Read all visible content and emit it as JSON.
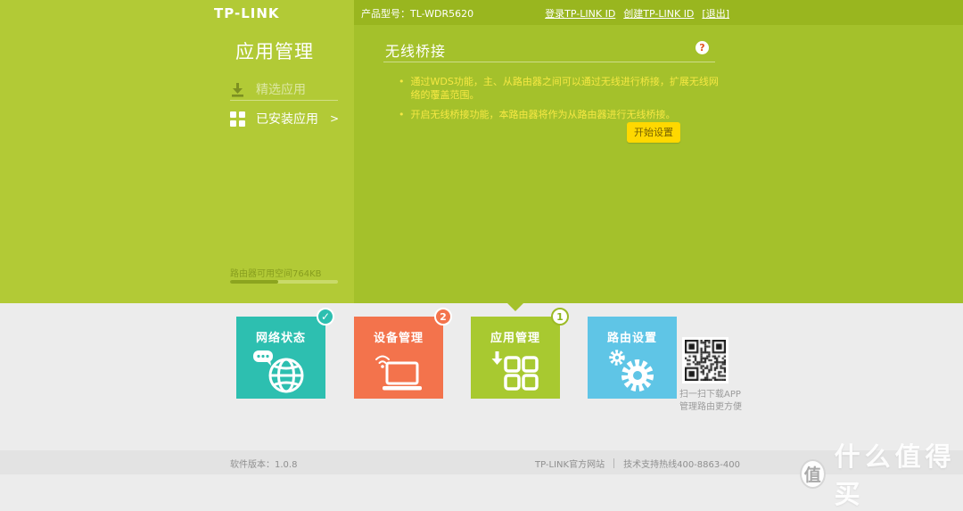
{
  "header": {
    "logo": "TP-LINK",
    "product_label": "产品型号：TL-WDR5620",
    "links": [
      {
        "label": "登录TP-LINK ID"
      },
      {
        "label": "创建TP-LINK ID"
      },
      {
        "label": "[退出]"
      }
    ]
  },
  "sidebar": {
    "title": "应用管理",
    "items": [
      {
        "label": "精选应用",
        "icon": "download-icon",
        "active": false
      },
      {
        "label": "已安装应用",
        "icon": "grid-icon",
        "active": true,
        "arrow": ">"
      }
    ],
    "storage": {
      "label": "路由器可用空间764KB",
      "percent": 45
    }
  },
  "main": {
    "title": "无线桥接",
    "help_icon": "?",
    "bullets": [
      "通过WDS功能，主、从路由器之间可以通过无线进行桥接，扩展无线网络的覆盖范围。",
      "开启无线桥接功能，本路由器将作为从路由器进行无线桥接。"
    ],
    "bullet_dot": "•",
    "start_button": "开始设置"
  },
  "nav_tiles": [
    {
      "label": "网络状态",
      "color": "#2dbfb0",
      "badge": "✓",
      "badge_type": "check",
      "icon": "globe-chat-icon"
    },
    {
      "label": "设备管理",
      "color": "#f3734c",
      "badge": "2",
      "badge_type": "count",
      "icon": "laptop-wifi-icon"
    },
    {
      "label": "应用管理",
      "color": "#a8c930",
      "badge": "1",
      "badge_type": "outline",
      "icon": "apps-download-icon",
      "active": true
    },
    {
      "label": "路由设置",
      "color": "#5fc5e6",
      "badge": "",
      "badge_type": "none",
      "icon": "gears-icon"
    }
  ],
  "qr": {
    "caption_line1": "扫一扫下载APP",
    "caption_line2": "管理路由更方便"
  },
  "footer": {
    "version": "软件版本：1.0.8",
    "site": "TP-LINK官方网站",
    "hotline": "技术支持热线400-8863-400"
  },
  "watermark": {
    "badge": "值",
    "text": "什么值得买"
  },
  "colors": {
    "sidebar_bg": "#b2ca36",
    "main_bg": "#a4c12b",
    "topbar_bg": "#99b61f",
    "bottom_bg": "#ececec",
    "footer_bg": "#e3e3e3",
    "bullet_yellow": "#f6e843",
    "button_yellow": "#ffd800",
    "tile_teal": "#2dbfb0",
    "tile_orange": "#f3734c",
    "tile_green": "#a8c930",
    "tile_blue": "#5fc5e6"
  }
}
